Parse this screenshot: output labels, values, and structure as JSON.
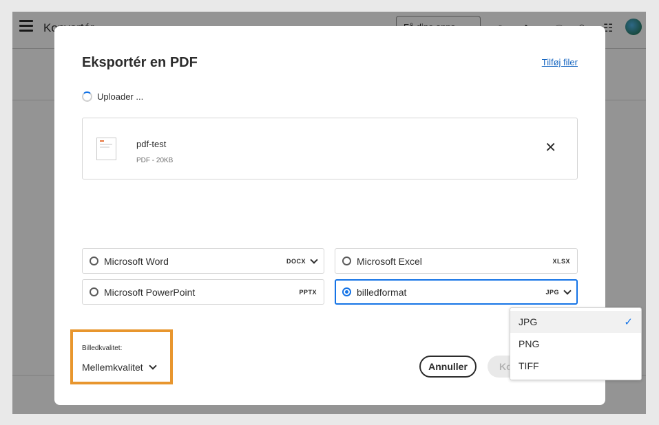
{
  "app": {
    "title": "Konvertér",
    "get_apps_label": "Få dine apps"
  },
  "dialog": {
    "title": "Eksportér en PDF",
    "add_files_link": "Tilføj filer",
    "status_text": "Uploader ...",
    "file": {
      "name": "pdf-test",
      "meta": "PDF - 20KB"
    },
    "formats": [
      {
        "label": "Microsoft Word",
        "ext": "DOCX",
        "has_menu": true,
        "selected": false
      },
      {
        "label": "Microsoft Excel",
        "ext": "XLSX",
        "has_menu": false,
        "selected": false
      },
      {
        "label": "Microsoft PowerPoint",
        "ext": "PPTX",
        "has_menu": false,
        "selected": false
      },
      {
        "label": "billedformat",
        "ext": "JPG",
        "has_menu": true,
        "selected": true
      }
    ],
    "quality": {
      "label": "Billedkvalitet:",
      "value": "Mellemkvalitet"
    },
    "buttons": {
      "cancel": "Annuller",
      "convert": "Ko"
    }
  },
  "dropdown": {
    "items": [
      {
        "label": "JPG",
        "checked": true
      },
      {
        "label": "PNG",
        "checked": false
      },
      {
        "label": "TIFF",
        "checked": false
      }
    ]
  },
  "colors": {
    "accent": "#1473e6",
    "highlight_box": "#e8962e",
    "link": "#1565c0"
  }
}
